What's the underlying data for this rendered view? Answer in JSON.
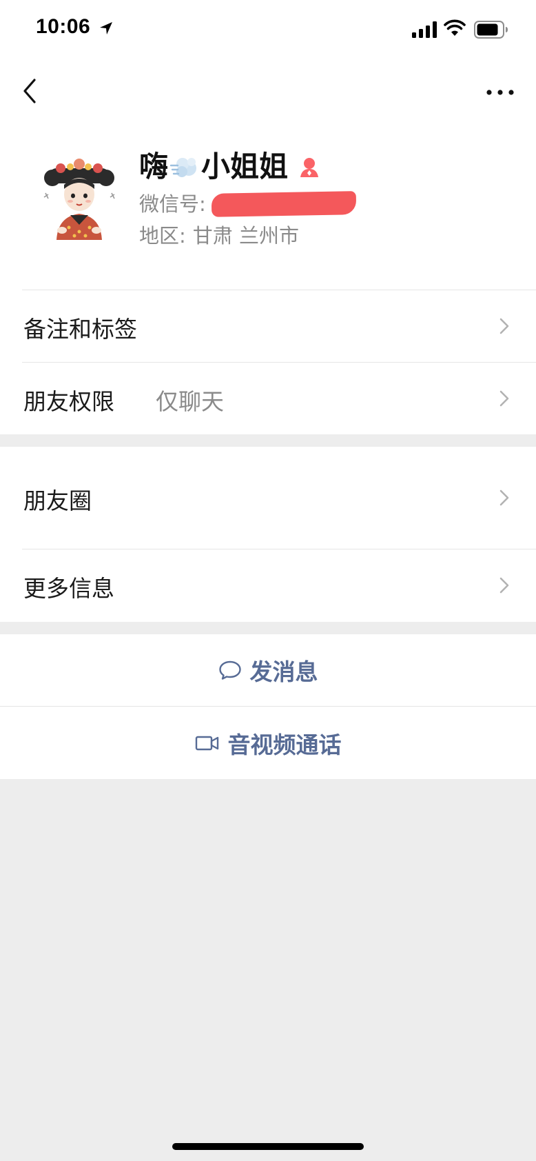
{
  "status_bar": {
    "time": "10:06",
    "icons": [
      "location-arrow-icon",
      "signal-icon",
      "wifi-icon",
      "battery-icon"
    ]
  },
  "nav": {
    "back_icon": "chevron-left-icon",
    "more_icon": "ellipsis-icon"
  },
  "profile": {
    "nickname_prefix": "嗨",
    "nickname_emoji": "dust-puff-emoji",
    "nickname_suffix": "小姐姐",
    "gender_icon": "female-icon",
    "wechat_id_label": "微信号:",
    "wechat_id_value_redacted": true,
    "region_label": "地区:",
    "region_value": "甘肃 兰州市"
  },
  "menu_group_1": [
    {
      "label": "备注和标签",
      "value": ""
    },
    {
      "label": "朋友权限",
      "value": "仅聊天"
    }
  ],
  "menu_group_2": [
    {
      "label": "朋友圈"
    },
    {
      "label": "更多信息"
    }
  ],
  "actions": {
    "message_label": "发消息",
    "message_icon": "chat-bubble-icon",
    "call_label": "音视频通话",
    "call_icon": "video-camera-icon"
  },
  "colors": {
    "link": "#576b95",
    "background_gray": "#ededed",
    "redaction": "#f4585b",
    "gender_female": "#fa6367"
  }
}
